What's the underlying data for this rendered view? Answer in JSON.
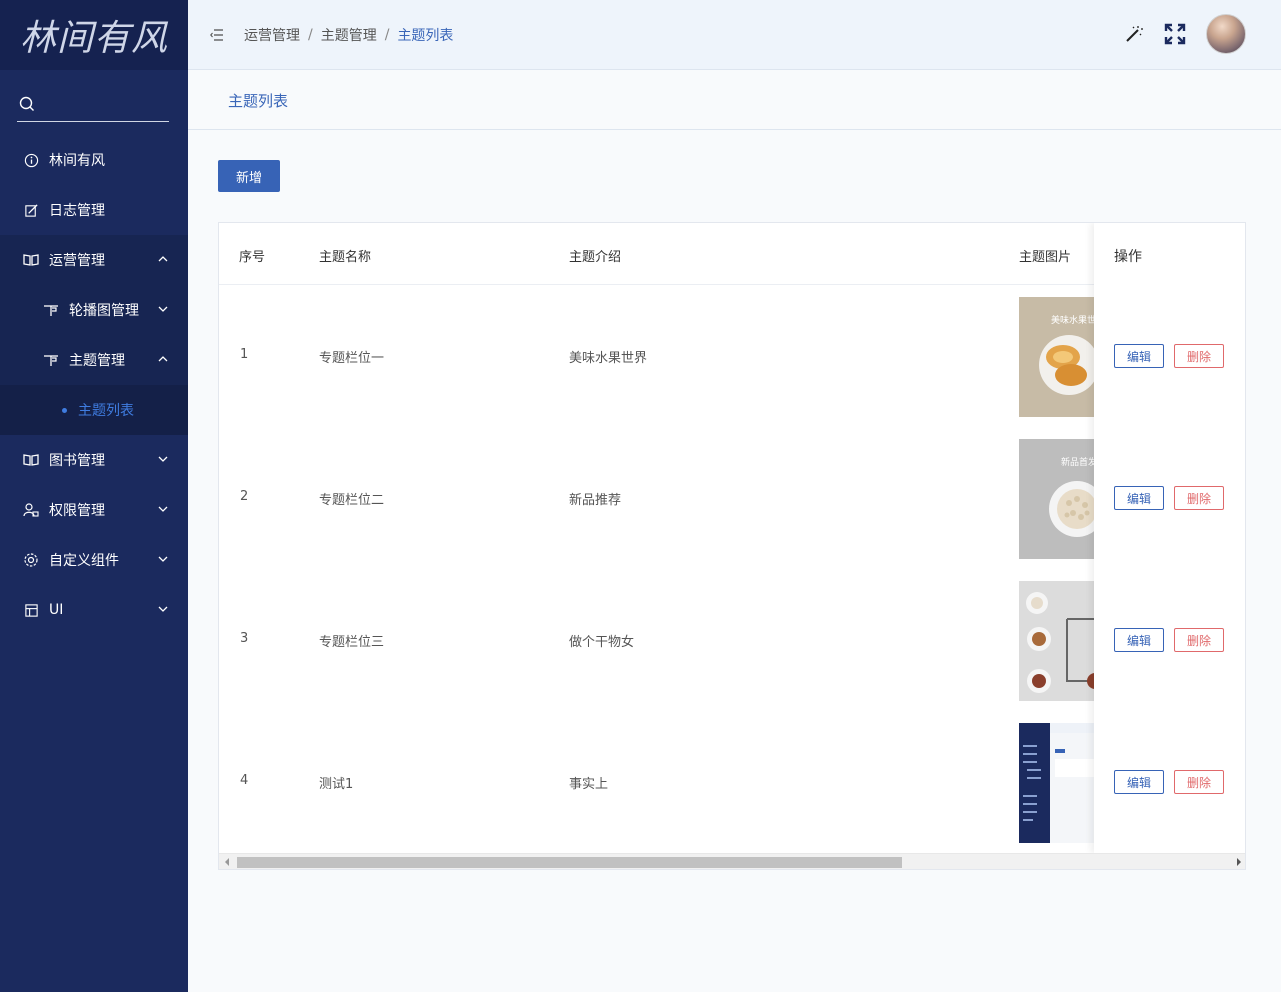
{
  "sidebar": {
    "logo": "林间有风",
    "search_placeholder": "",
    "items": [
      {
        "label": "林间有风",
        "icon": "info-icon"
      },
      {
        "label": "日志管理",
        "icon": "edit-icon"
      },
      {
        "label": "运营管理",
        "icon": "book-icon",
        "expanded": true
      },
      {
        "label": "轮播图管理",
        "icon": "flag-icon"
      },
      {
        "label": "主题管理",
        "icon": "flag-icon",
        "expanded": true
      },
      {
        "label": "主题列表",
        "active": true
      },
      {
        "label": "图书管理",
        "icon": "book-icon"
      },
      {
        "label": "权限管理",
        "icon": "user-lock-icon"
      },
      {
        "label": "自定义组件",
        "icon": "gear-icon"
      },
      {
        "label": "UI",
        "icon": "layout-icon"
      }
    ]
  },
  "header": {
    "breadcrumb": [
      "运营管理",
      "主题管理",
      "主题列表"
    ],
    "separator": "/"
  },
  "page": {
    "title": "主题列表",
    "add_label": "新增"
  },
  "table": {
    "columns": [
      "序号",
      "主题名称",
      "主题介绍",
      "主题图片",
      "操作"
    ],
    "rows": [
      {
        "index": "1",
        "name": "专题栏位一",
        "intro": "美味水果世界",
        "image": "fruit-plate-image",
        "image_caption": "美味水果世"
      },
      {
        "index": "2",
        "name": "专题栏位二",
        "intro": "新品推荐",
        "image": "grain-plate-image",
        "image_caption": "新品首发"
      },
      {
        "index": "3",
        "name": "专题栏位三",
        "intro": "做个干物女",
        "image": "dried-goods-image"
      },
      {
        "index": "4",
        "name": "测试1",
        "intro": "事实上",
        "image": "screenshot-image"
      }
    ],
    "edit_label": "编辑",
    "delete_label": "删除"
  },
  "colors": {
    "sidebar_bg": "#1b2a5e",
    "accent": "#3763b6",
    "danger": "#e0696b"
  }
}
